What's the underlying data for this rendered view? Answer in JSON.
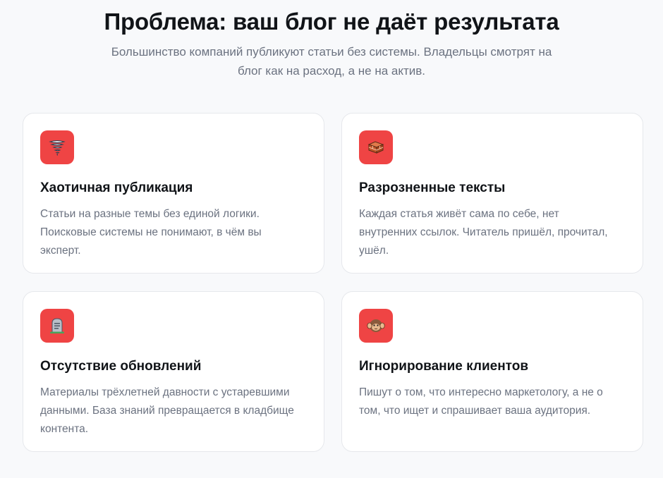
{
  "header": {
    "title": "Проблема: ваш блог не даёт результата",
    "subtitle": "Большинство компаний публикуют статьи без системы. Владельцы смотрят на блог как на расход, а не на актив."
  },
  "colors": {
    "accent": "#ef4444",
    "card_bg": "#ffffff",
    "page_bg": "#f8f9fb",
    "muted_text": "#6b7280"
  },
  "cards": [
    {
      "icon": "tornado-icon",
      "title": "Хаотичная публикация",
      "description": "Статьи на разные темы без единой логики. Поисковые системы не понимают, в чём вы эксперт."
    },
    {
      "icon": "bricks-icon",
      "title": "Разрозненные тексты",
      "description": "Каждая статья живёт сама по себе, нет внутренних ссылок. Читатель пришёл, прочитал, ушёл."
    },
    {
      "icon": "headstone-icon",
      "title": "Отсутствие обновлений",
      "description": "Материалы трёхлетней давности с устаревшими данными. База знаний превращается в кладбище контента."
    },
    {
      "icon": "hear-no-evil-monkey-icon",
      "title": "Игнорирование клиентов",
      "description": "Пишут о том, что интересно маркетологу, а не о том, что ищет и спрашивает ваша аудитория."
    }
  ]
}
